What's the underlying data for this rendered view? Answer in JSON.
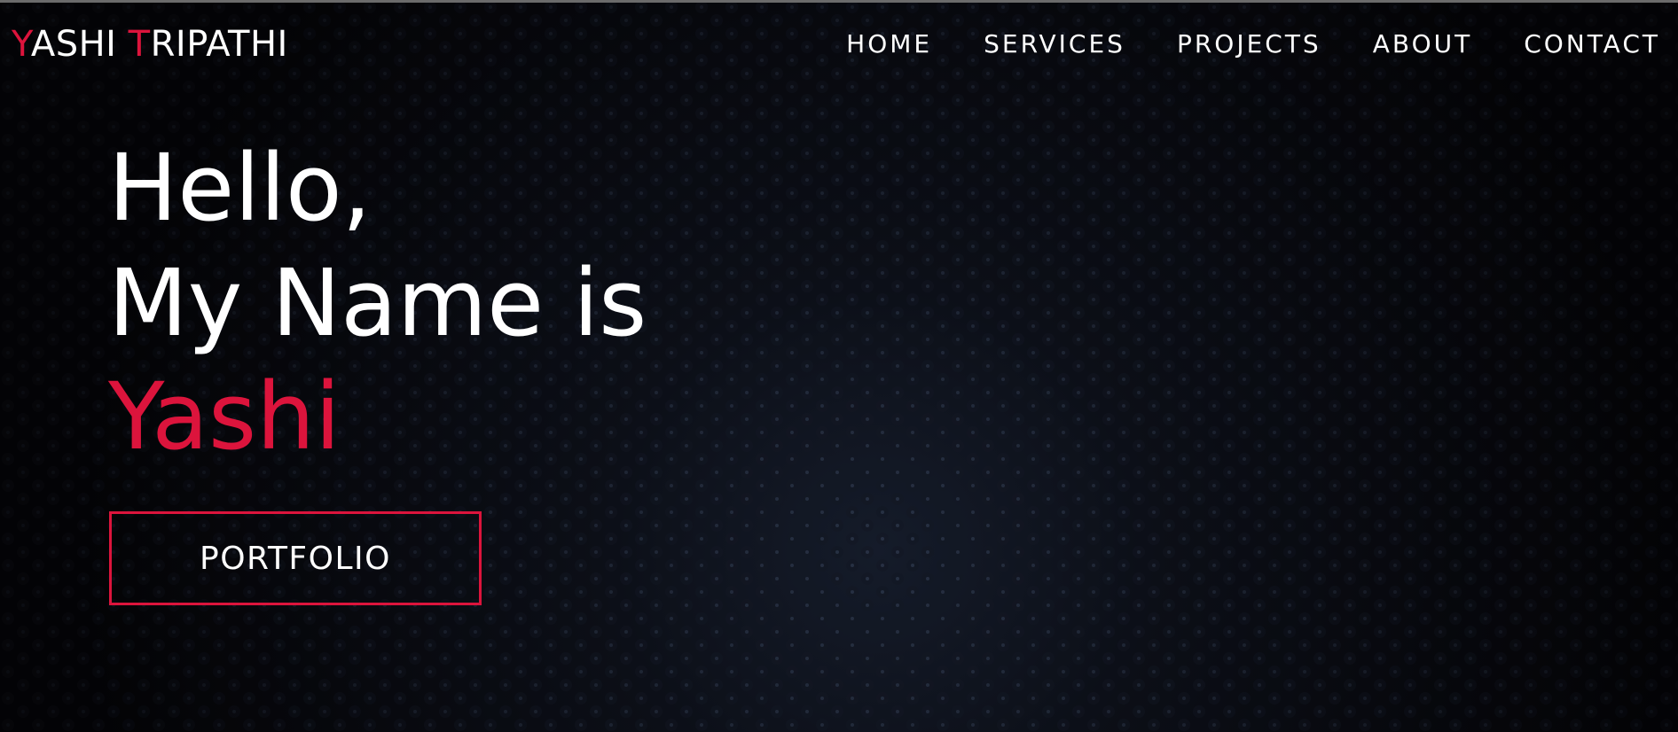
{
  "logo": {
    "first_initial": "Y",
    "first_rest": "ASHI ",
    "last_initial": "T",
    "last_rest": "RIPATHI"
  },
  "nav": {
    "items": [
      {
        "label": "HOME"
      },
      {
        "label": "SERVICES"
      },
      {
        "label": "PROJECTS"
      },
      {
        "label": "ABOUT"
      },
      {
        "label": "CONTACT"
      }
    ]
  },
  "hero": {
    "line1": "Hello,",
    "line2": "My Name is",
    "name": "Yashi",
    "button_label": "PORTFOLIO"
  },
  "colors": {
    "accent": "#dc143c",
    "background": "#07080c",
    "text": "#ffffff"
  }
}
